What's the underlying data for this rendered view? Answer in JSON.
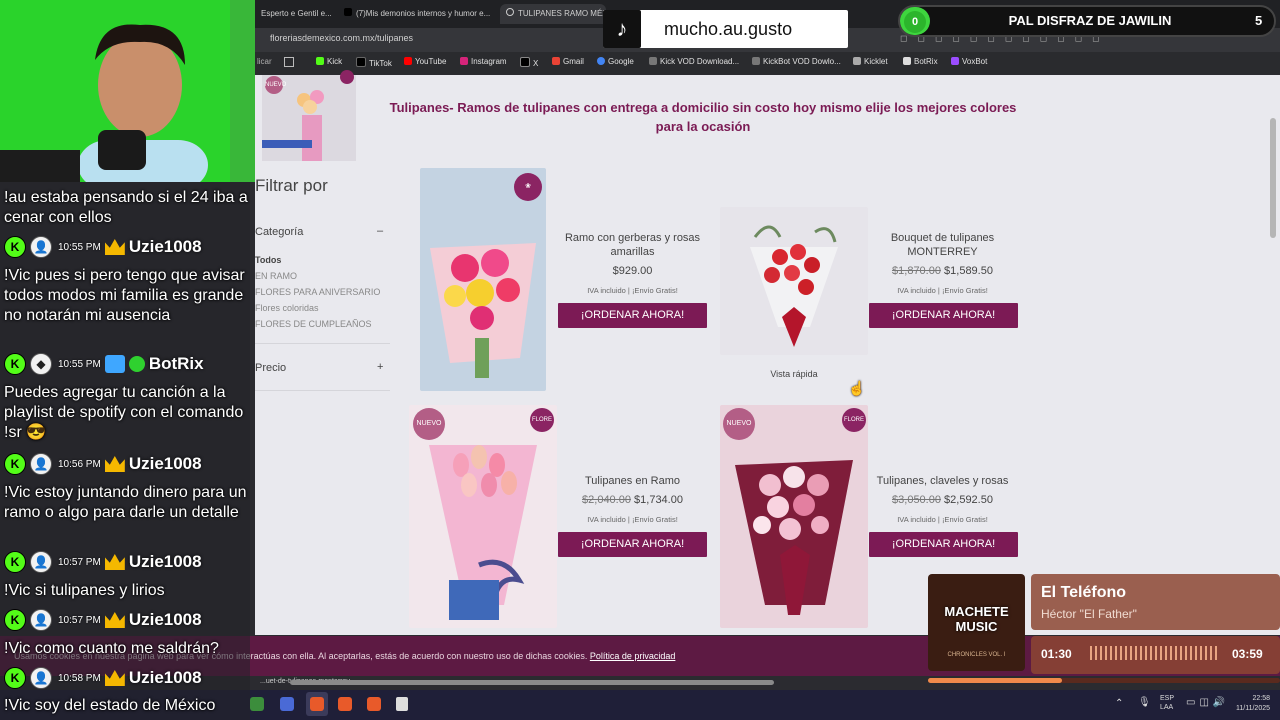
{
  "browser": {
    "tabs": [
      "Esperto e Gentil e...",
      "(7)Mis demonios internos y humor e...",
      "TULIPANES RAMO MÉX..."
    ],
    "url": "floreriasdemexico.com.mx/tulipanes",
    "bookmarks": [
      "Kick",
      "TikTok",
      "YouTube",
      "Instagram",
      "X",
      "Gmail",
      "Google",
      "Kick VOD Download...",
      "KickBot VOD Dowlo...",
      "Kicklet",
      "BotRix",
      "VoxBot"
    ],
    "status_url": "...uet-de-tulipanes-monterrey"
  },
  "page": {
    "title": "Tulipanes- Ramos de tulipanes con entrega a domicilio sin costo hoy mismo elije los mejores colores para la ocasión",
    "filter_title": "Filtrar por",
    "category_label": "Categoría",
    "category_toggle": "–",
    "categories": [
      "Todos",
      "EN RAMO",
      "FLORES PARA ANIVERSARIO",
      "Flores coloridas",
      "FLORES DE CUMPLEAÑOS"
    ],
    "price_label": "Precio",
    "price_toggle": "+",
    "quick_view": "Vista rápida",
    "badge_new": "NUEVO",
    "badge_flower": "FLORE",
    "products": [
      {
        "name": "Ramo con gerberas y rosas amarillas",
        "old_price": "",
        "price": "$929.00",
        "iva": "IVA incluido | ¡Envío Gratis!",
        "button": "¡ORDENAR AHORA!"
      },
      {
        "name": "Bouquet de tulipanes MONTERREY",
        "old_price": "$1,870.00",
        "price": "$1,589.50",
        "iva": "IVA incluido | ¡Envío Gratis!",
        "button": "¡ORDENAR AHORA!"
      },
      {
        "name": "Tulipanes en Ramo",
        "old_price": "$2,040.00",
        "price": "$1,734.00",
        "iva": "IVA incluido | ¡Envío Gratis!",
        "button": "¡ORDENAR AHORA!"
      },
      {
        "name": "Tulipanes, claveles y rosas",
        "old_price": "$3,050.00",
        "price": "$2,592.50",
        "iva": "IVA incluido | ¡Envío Gratis!",
        "button": "¡ORDENAR AHORA!"
      }
    ],
    "cookie_text": "Usamos cookies en nuestra página web para ver cómo interactúas con ella. Al aceptarlas, estás de acuerdo con nuestro uso de dichas cookies.",
    "cookie_link": "Política de privacidad"
  },
  "chat": {
    "messages": [
      {
        "text": "!au estaba pensando si el 24 iba a cenar con ellos"
      },
      {
        "time": "10:55 PM",
        "user": "Uzie1008",
        "text": "!Vic pues si pero tengo que avisar todos modos mi familia es grande no notarán mi ausencia"
      },
      {
        "time": "10:55 PM",
        "user": "BotRix",
        "text": "Puedes agregar tu canción a la playlist de spotify con el comando !sr 😎"
      },
      {
        "time": "10:56 PM",
        "user": "Uzie1008",
        "text": "!Vic estoy juntando dinero para un ramo o algo para darle un detalle"
      },
      {
        "time": "10:57 PM",
        "user": "Uzie1008",
        "text": "!Vic si tulipanes y lirios"
      },
      {
        "time": "10:57 PM",
        "user": "Uzie1008",
        "text": "!Vic como cuanto me saldrán?"
      },
      {
        "time": "10:58 PM",
        "user": "Uzie1008",
        "text": "!Vic soy del estado de México"
      }
    ]
  },
  "overlay": {
    "tiktok_name": "mucho.au.gusto",
    "goal_count": "0",
    "goal_title": "PAL DISFRAZ DE JAWILIN",
    "goal_target": "5",
    "music_title": "El Teléfono",
    "music_artist": "Héctor \"El Father\"",
    "music_elapsed": "01:30",
    "music_total": "03:59",
    "album_text": "MACHETE MUSIC",
    "album_sub": "CHRONICLES VOL. I",
    "music_progress": 0.38
  },
  "taskbar": {
    "lang": "ESP\nLAA",
    "time": "22:58",
    "date": "11/11/2025"
  },
  "colors": {
    "brand": "#7c1a55",
    "kick": "#53fc18"
  }
}
